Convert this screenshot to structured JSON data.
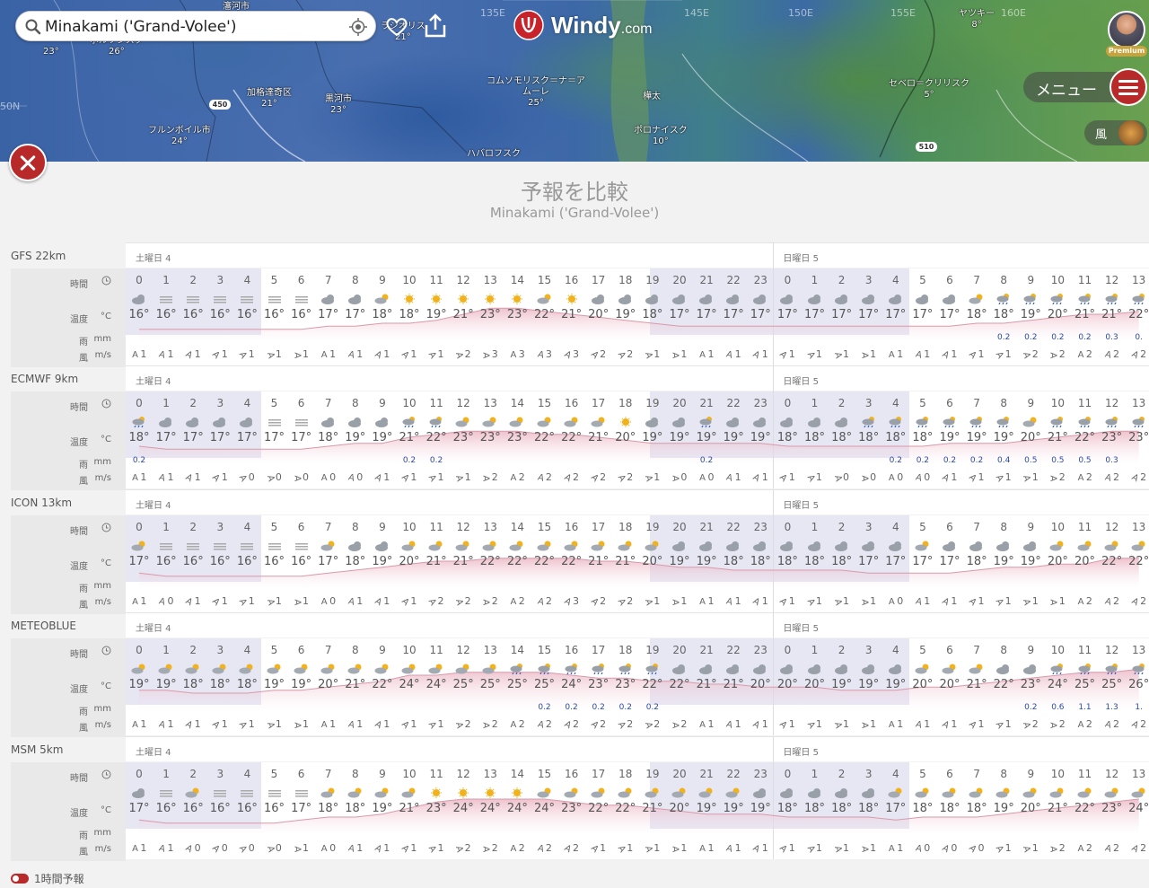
{
  "search": {
    "value": "Minakami ('Grand-Volee')"
  },
  "brand": {
    "name": "Windy",
    "tld": ".com"
  },
  "menu": {
    "label": "メニュー"
  },
  "layer": {
    "label": "風"
  },
  "premium": "Premium",
  "map": {
    "graticule": [
      "135E",
      "145E",
      "150E",
      "155E",
      "160E",
      "50N"
    ],
    "badges": [
      "450",
      "510"
    ],
    "places": [
      {
        "name": "瀋河市",
        "temp": ""
      },
      {
        "name": "",
        "temp": "23°"
      },
      {
        "name": "ポルツンスク",
        "temp": "26°"
      },
      {
        "name": "加格達奇区",
        "temp": "21°"
      },
      {
        "name": "黒河市",
        "temp": "23°"
      },
      {
        "name": "フルンボイル市",
        "temp": "24°"
      },
      {
        "name": "コムソモリスク＝ナ＝アムーレ",
        "temp": "25°"
      },
      {
        "name": "ハバロフスク",
        "temp": ""
      },
      {
        "name": "樺太",
        "temp": ""
      },
      {
        "name": "ポロナイスク",
        "temp": "10°"
      },
      {
        "name": "セベロ＝クリリスク",
        "temp": "5°"
      },
      {
        "name": "ヤツキー",
        "temp": "8°"
      },
      {
        "name": "ラジオリス",
        "temp": "21°"
      }
    ]
  },
  "page": {
    "title": "予報を比較",
    "subtitle": "Minakami ('Grand-Volee')"
  },
  "labels": {
    "time": "時間",
    "temp": "温度",
    "temp_unit": "°C",
    "rain": "雨",
    "rain_unit": "mm",
    "wind": "風",
    "wind_unit": "m/s"
  },
  "days": [
    "土曜日 4",
    "日曜日 5"
  ],
  "hours": [
    0,
    1,
    2,
    3,
    4,
    5,
    6,
    7,
    8,
    9,
    10,
    11,
    12,
    13,
    14,
    15,
    16,
    17,
    18,
    19,
    20,
    21,
    22,
    23,
    0,
    1,
    2,
    3,
    4,
    5,
    6,
    7,
    8,
    9,
    10,
    11,
    12,
    13
  ],
  "models": [
    {
      "name": "GFS 22km",
      "icons": "CFFFFFFCCPSSSSSPSCCCCCCCCCCCCCCPRRRRRR",
      "temps": [
        16,
        16,
        16,
        16,
        16,
        16,
        16,
        17,
        17,
        18,
        18,
        19,
        21,
        23,
        23,
        22,
        21,
        20,
        19,
        18,
        17,
        17,
        17,
        17,
        17,
        17,
        17,
        17,
        17,
        17,
        17,
        18,
        18,
        19,
        20,
        21,
        21,
        22
      ],
      "rain": {
        "32": "0.2",
        "33": "0.2",
        "34": "0.2",
        "35": "0.2",
        "36": "0.3",
        "37": "0."
      },
      "wind": [
        1,
        1,
        1,
        1,
        1,
        1,
        1,
        1,
        1,
        1,
        1,
        1,
        2,
        3,
        3,
        3,
        3,
        2,
        2,
        1,
        1,
        1,
        1,
        1,
        1,
        1,
        1,
        1,
        1,
        1,
        1,
        1,
        1,
        2,
        2,
        2,
        2,
        2
      ]
    },
    {
      "name": "ECMWF 9km",
      "icons": "RCCCCFFCCCRRPPPPPPSCCRCCCCCRRRRRRPRRRR",
      "temps": [
        18,
        17,
        17,
        17,
        17,
        17,
        17,
        18,
        19,
        19,
        21,
        22,
        23,
        23,
        23,
        22,
        22,
        21,
        20,
        19,
        19,
        19,
        19,
        19,
        18,
        18,
        18,
        18,
        18,
        18,
        19,
        19,
        19,
        20,
        21,
        22,
        23,
        23
      ],
      "rain": {
        "0": "0.2",
        "10": "0.2",
        "11": "0.2",
        "21": "0.2",
        "28": "0.2",
        "29": "0.2",
        "30": "0.2",
        "31": "0.2",
        "32": "0.4",
        "33": "0.5",
        "34": "0.5",
        "35": "0.5",
        "36": "0.3"
      },
      "wind": [
        1,
        1,
        1,
        1,
        0,
        0,
        0,
        0,
        0,
        1,
        1,
        1,
        1,
        2,
        2,
        2,
        2,
        2,
        2,
        1,
        0,
        0,
        1,
        1,
        1,
        1,
        0,
        0,
        0,
        0,
        1,
        1,
        1,
        1,
        2,
        2,
        2,
        2
      ]
    },
    {
      "name": "ICON 13km",
      "icons": "PFFFFFFPCCPPPPPPPPPPCCCCCCCCCPCCCCPPPP",
      "temps": [
        17,
        16,
        16,
        16,
        16,
        16,
        16,
        17,
        18,
        19,
        20,
        21,
        21,
        22,
        22,
        22,
        22,
        21,
        21,
        20,
        19,
        19,
        18,
        18,
        18,
        18,
        18,
        17,
        17,
        17,
        17,
        18,
        19,
        19,
        20,
        20,
        22,
        22
      ],
      "rain": {},
      "wind": [
        1,
        0,
        1,
        1,
        1,
        1,
        1,
        0,
        1,
        1,
        1,
        2,
        2,
        2,
        2,
        2,
        3,
        2,
        2,
        1,
        1,
        1,
        1,
        1,
        1,
        1,
        1,
        1,
        0,
        1,
        1,
        1,
        1,
        1,
        1,
        2,
        2,
        2
      ]
    },
    {
      "name": "METEOBLUE",
      "icons": "PPPPPPPPPPPPPPRRRRRRCCCCCCCCCPPPCCRRRR",
      "temps": [
        19,
        19,
        18,
        18,
        18,
        19,
        19,
        20,
        21,
        22,
        24,
        24,
        25,
        25,
        25,
        25,
        24,
        23,
        23,
        22,
        22,
        21,
        21,
        20,
        20,
        20,
        19,
        19,
        19,
        20,
        20,
        21,
        22,
        23,
        24,
        25,
        25,
        26
      ],
      "rain": {
        "15": "0.2",
        "16": "0.2",
        "17": "0.2",
        "18": "0.2",
        "19": "0.2",
        "33": "0.2",
        "34": "0.6",
        "35": "1.1",
        "36": "1.3",
        "37": "1."
      },
      "wind": [
        1,
        1,
        1,
        1,
        1,
        1,
        1,
        1,
        1,
        1,
        1,
        1,
        2,
        2,
        2,
        2,
        2,
        2,
        2,
        2,
        2,
        1,
        1,
        1,
        1,
        1,
        1,
        1,
        1,
        1,
        1,
        1,
        1,
        2,
        2,
        2,
        2,
        2
      ]
    },
    {
      "name": "MSM 5km",
      "icons": "CFPFFFFPPPPSSSSPPPPPPPPCCCCCPPPPPPPPPP",
      "temps": [
        17,
        16,
        16,
        16,
        16,
        16,
        17,
        18,
        18,
        19,
        21,
        23,
        24,
        24,
        24,
        24,
        23,
        22,
        22,
        21,
        20,
        19,
        19,
        19,
        18,
        18,
        18,
        18,
        17,
        18,
        18,
        18,
        19,
        20,
        21,
        22,
        23,
        24
      ],
      "rain": {},
      "wind": [
        1,
        1,
        0,
        0,
        0,
        0,
        1,
        0,
        1,
        1,
        1,
        1,
        2,
        2,
        2,
        2,
        2,
        1,
        1,
        1,
        1,
        1,
        1,
        1,
        1,
        1,
        1,
        1,
        1,
        0,
        0,
        0,
        1,
        1,
        2,
        2,
        2,
        2
      ]
    }
  ],
  "footer": {
    "toggle_label": "1時間予報"
  }
}
